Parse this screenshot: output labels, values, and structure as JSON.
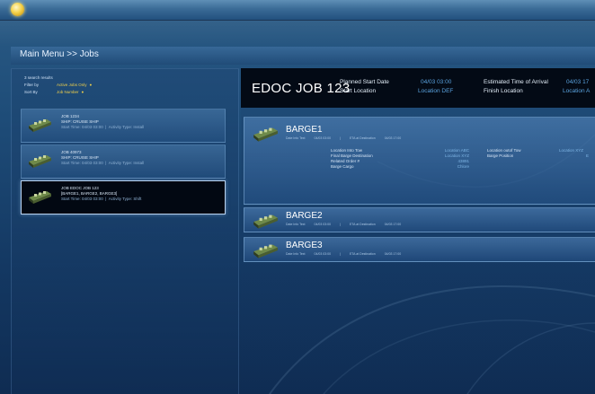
{
  "breadcrumb": "Main Menu >> Jobs",
  "search": {
    "results": "3 search results",
    "filter_label": "Filter by",
    "filter_value": "Active Jobs Only",
    "sort_label": "Sort By",
    "sort_value": "Job Number"
  },
  "jobs": [
    {
      "title": "JOB 1234",
      "subtitle": "SHIP: CRUISE SHIP",
      "start": "Start Time: 04/03 03:00",
      "activity": "Activity Type: Install"
    },
    {
      "title": "JOB 40973",
      "subtitle": "SHIP: CRUISE SHIP",
      "start": "Start Time: 04/03 03:00",
      "activity": "Activity Type: Install"
    },
    {
      "title": "JOB EDOC JOB 123",
      "subtitle": "[BARGE1, BARGE2, BARGE3]",
      "start": "Start Time: 04/03 03:00",
      "activity": "Activity Type: Shift"
    }
  ],
  "detail": {
    "job_title": "EDOC JOB 123",
    "planned_start_label": "Planned Start Date",
    "planned_start_value": "04/03 03:00",
    "start_location_label": "Start Location",
    "start_location_value": "Location DEF",
    "eta_label": "Estimated Time of Arrival",
    "eta_value": "04/03 17",
    "finish_location_label": "Finish Location",
    "finish_location_value": "Location A"
  },
  "barges": [
    {
      "name": "BARGE1",
      "meta_date": "Date Info Text",
      "meta_time": "04/03 03:00",
      "meta_eta": "ETA at Destination",
      "meta_eta_val": "04/03 17:00",
      "details": {
        "l1": "Location Into Tow",
        "v1": "Location ABC",
        "l2": "Final Barge Destination",
        "v2": "Location XYZ",
        "l3": "Related Order #",
        "v3": "43891",
        "l4": "Barge Cargo",
        "v4": "Chlore",
        "l5": "Location outof Tow",
        "v5": "Location XYZ",
        "l6": "Barge Position",
        "v6": "E"
      }
    },
    {
      "name": "BARGE2",
      "meta_date": "Date Info Text",
      "meta_time": "04/03 03:00",
      "meta_eta": "ETA at Destination",
      "meta_eta_val": "04/03 17:00"
    },
    {
      "name": "BARGE3",
      "meta_date": "Date Info Text",
      "meta_time": "04/03 03:00",
      "meta_eta": "ETA at Destination",
      "meta_eta_val": "04/03 17:00"
    }
  ],
  "icons": {
    "app": "app-orb-icon",
    "barge": "barge-icon"
  },
  "colors": {
    "accent": "#5aa2de",
    "highlight": "#f0d04a",
    "header_bg": "#030a15"
  }
}
